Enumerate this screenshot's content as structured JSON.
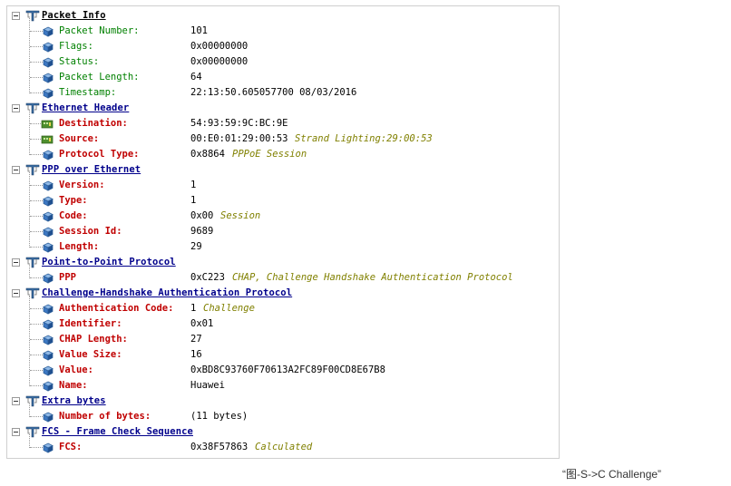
{
  "caption": "“图-S->C Challenge”",
  "colors": {
    "section_title": "#00008b",
    "field_name_plain": "#008000",
    "field_name_protocol": "#c00000",
    "annotation": "#808000"
  },
  "sections": [
    {
      "title": "Packet Info",
      "fields": [
        {
          "name": "Packet Number:",
          "value": "101",
          "icon": "info-cube-icon"
        },
        {
          "name": "Flags:",
          "value": "0x00000000",
          "icon": "info-cube-icon"
        },
        {
          "name": "Status:",
          "value": "0x00000000",
          "icon": "info-cube-icon"
        },
        {
          "name": "Packet Length:",
          "value": "64",
          "icon": "info-cube-icon"
        },
        {
          "name": "Timestamp:",
          "value": "22:13:50.605057700 08/03/2016",
          "icon": "info-cube-icon"
        }
      ]
    },
    {
      "title": "Ethernet Header",
      "fields": [
        {
          "name": "Destination:",
          "value": "54:93:59:9C:BC:9E",
          "icon": "network-adapter-icon"
        },
        {
          "name": "Source:",
          "value": "00:E0:01:29:00:53",
          "note": "Strand Lighting:29:00:53",
          "icon": "network-adapter-icon"
        },
        {
          "name": "Protocol Type:",
          "value": "0x8864",
          "note": "PPPoE Session",
          "icon": "field-cube-icon"
        }
      ]
    },
    {
      "title": "PPP over Ethernet",
      "fields": [
        {
          "name": "Version:",
          "value": "1",
          "icon": "field-cube-icon"
        },
        {
          "name": "Type:",
          "value": "1",
          "icon": "field-cube-icon"
        },
        {
          "name": "Code:",
          "value": "0x00",
          "note": "Session",
          "icon": "field-cube-icon"
        },
        {
          "name": "Session Id:",
          "value": "9689",
          "icon": "field-cube-icon"
        },
        {
          "name": "Length:",
          "value": "29",
          "icon": "field-cube-icon"
        }
      ]
    },
    {
      "title": "Point-to-Point Protocol",
      "fields": [
        {
          "name": "PPP",
          "value": "0xC223",
          "note": "CHAP, Challenge Handshake Authentication Protocol",
          "icon": "field-cube-icon"
        }
      ]
    },
    {
      "title": "Challenge-Handshake Authentication Protocol",
      "fields": [
        {
          "name": "Authentication Code:",
          "value": "1",
          "note": "Challenge",
          "icon": "field-cube-icon"
        },
        {
          "name": "Identifier:",
          "value": "0x01",
          "icon": "field-cube-icon"
        },
        {
          "name": "CHAP Length:",
          "value": "27",
          "icon": "field-cube-icon"
        },
        {
          "name": "Value Size:",
          "value": "16",
          "icon": "field-cube-icon"
        },
        {
          "name": "Value:",
          "value": "0xBD8C93760F70613A2FC89F00CD8E67B8",
          "icon": "field-cube-icon"
        },
        {
          "name": "Name:",
          "value": "Huawei",
          "icon": "field-cube-icon"
        }
      ]
    },
    {
      "title": "Extra bytes",
      "fields": [
        {
          "name": "Number of bytes:",
          "value": "(11 bytes)",
          "icon": "field-cube-icon"
        }
      ]
    },
    {
      "title": "FCS - Frame Check Sequence",
      "fields": [
        {
          "name": "FCS:",
          "value": "0x38F57863",
          "note": "Calculated",
          "icon": "field-cube-icon"
        }
      ]
    }
  ]
}
